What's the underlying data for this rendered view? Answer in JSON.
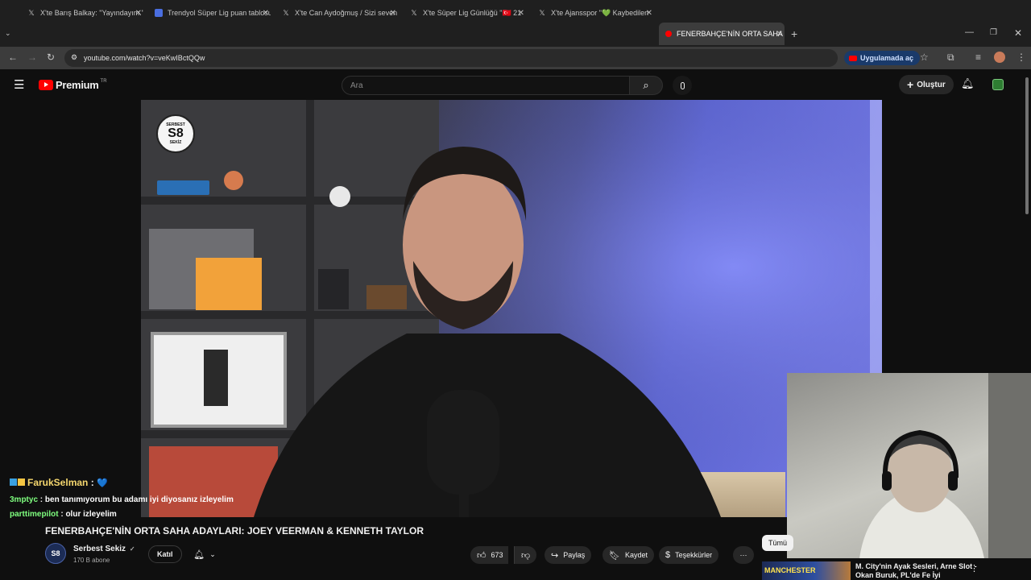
{
  "browser": {
    "tabs": [
      {
        "title": "X'te Barış Balkay: \"Yayındayım.\"",
        "icon": "x-logo-icon"
      },
      {
        "title": "Trendyol Süper Lig puan tablosu",
        "icon": "doc-icon"
      },
      {
        "title": "X'te Can Aydoğmuş / Sizi seven",
        "icon": "x-logo-icon"
      },
      {
        "title": "X'te Süper Lig Günlüğü \"🇹🇷 21",
        "icon": "x-logo-icon"
      },
      {
        "title": "X'te Ajansspor \"💚 Kaybedilen",
        "icon": "x-logo-icon"
      },
      {
        "title": "FENERBAHÇE'NİN ORTA SAHA",
        "icon": "youtube-icon"
      }
    ],
    "url": "youtube.com/watch?v=veKwIBctQQw",
    "open_in_app_label": "Uygulamada aç"
  },
  "youtube": {
    "logo_text": "Premium",
    "logo_badge": "TR",
    "search_placeholder": "Ara",
    "create_label": "Oluştur"
  },
  "video": {
    "title": "FENERBAHÇE'NİN ORTA SAHA ADAYLARI: JOEY VEERMAN & KENNETH TAYLOR",
    "channel_logo": "S8",
    "channel_logo_top": "SERBEST",
    "channel_logo_bottom": "SEKİZ"
  },
  "channel": {
    "name": "Serbest Sekiz",
    "subscribers": "170 B abone",
    "join_label": "Katıl"
  },
  "actions": {
    "likes": "673",
    "share": "Paylaş",
    "save": "Kaydet",
    "thanks": "Teşekkürler",
    "all": "Tümü"
  },
  "chat": [
    {
      "user": "FarukSelman",
      "message": "💙",
      "color": "#f5d76e"
    },
    {
      "user": "3mptyc",
      "message": "ben tanımıyorum bu adamı iyi diyosanız izleyelim",
      "color": "#7fff7f"
    },
    {
      "user": "parttimepilot",
      "message": "olur izleyelim",
      "color": "#7fff7f"
    }
  ],
  "recommendation": {
    "thumbnail_text": "MANCHESTER",
    "title": "M. City'nin Ayak Sesleri, Arne Slot - Okan Buruk, PL'de Fe İyi"
  }
}
